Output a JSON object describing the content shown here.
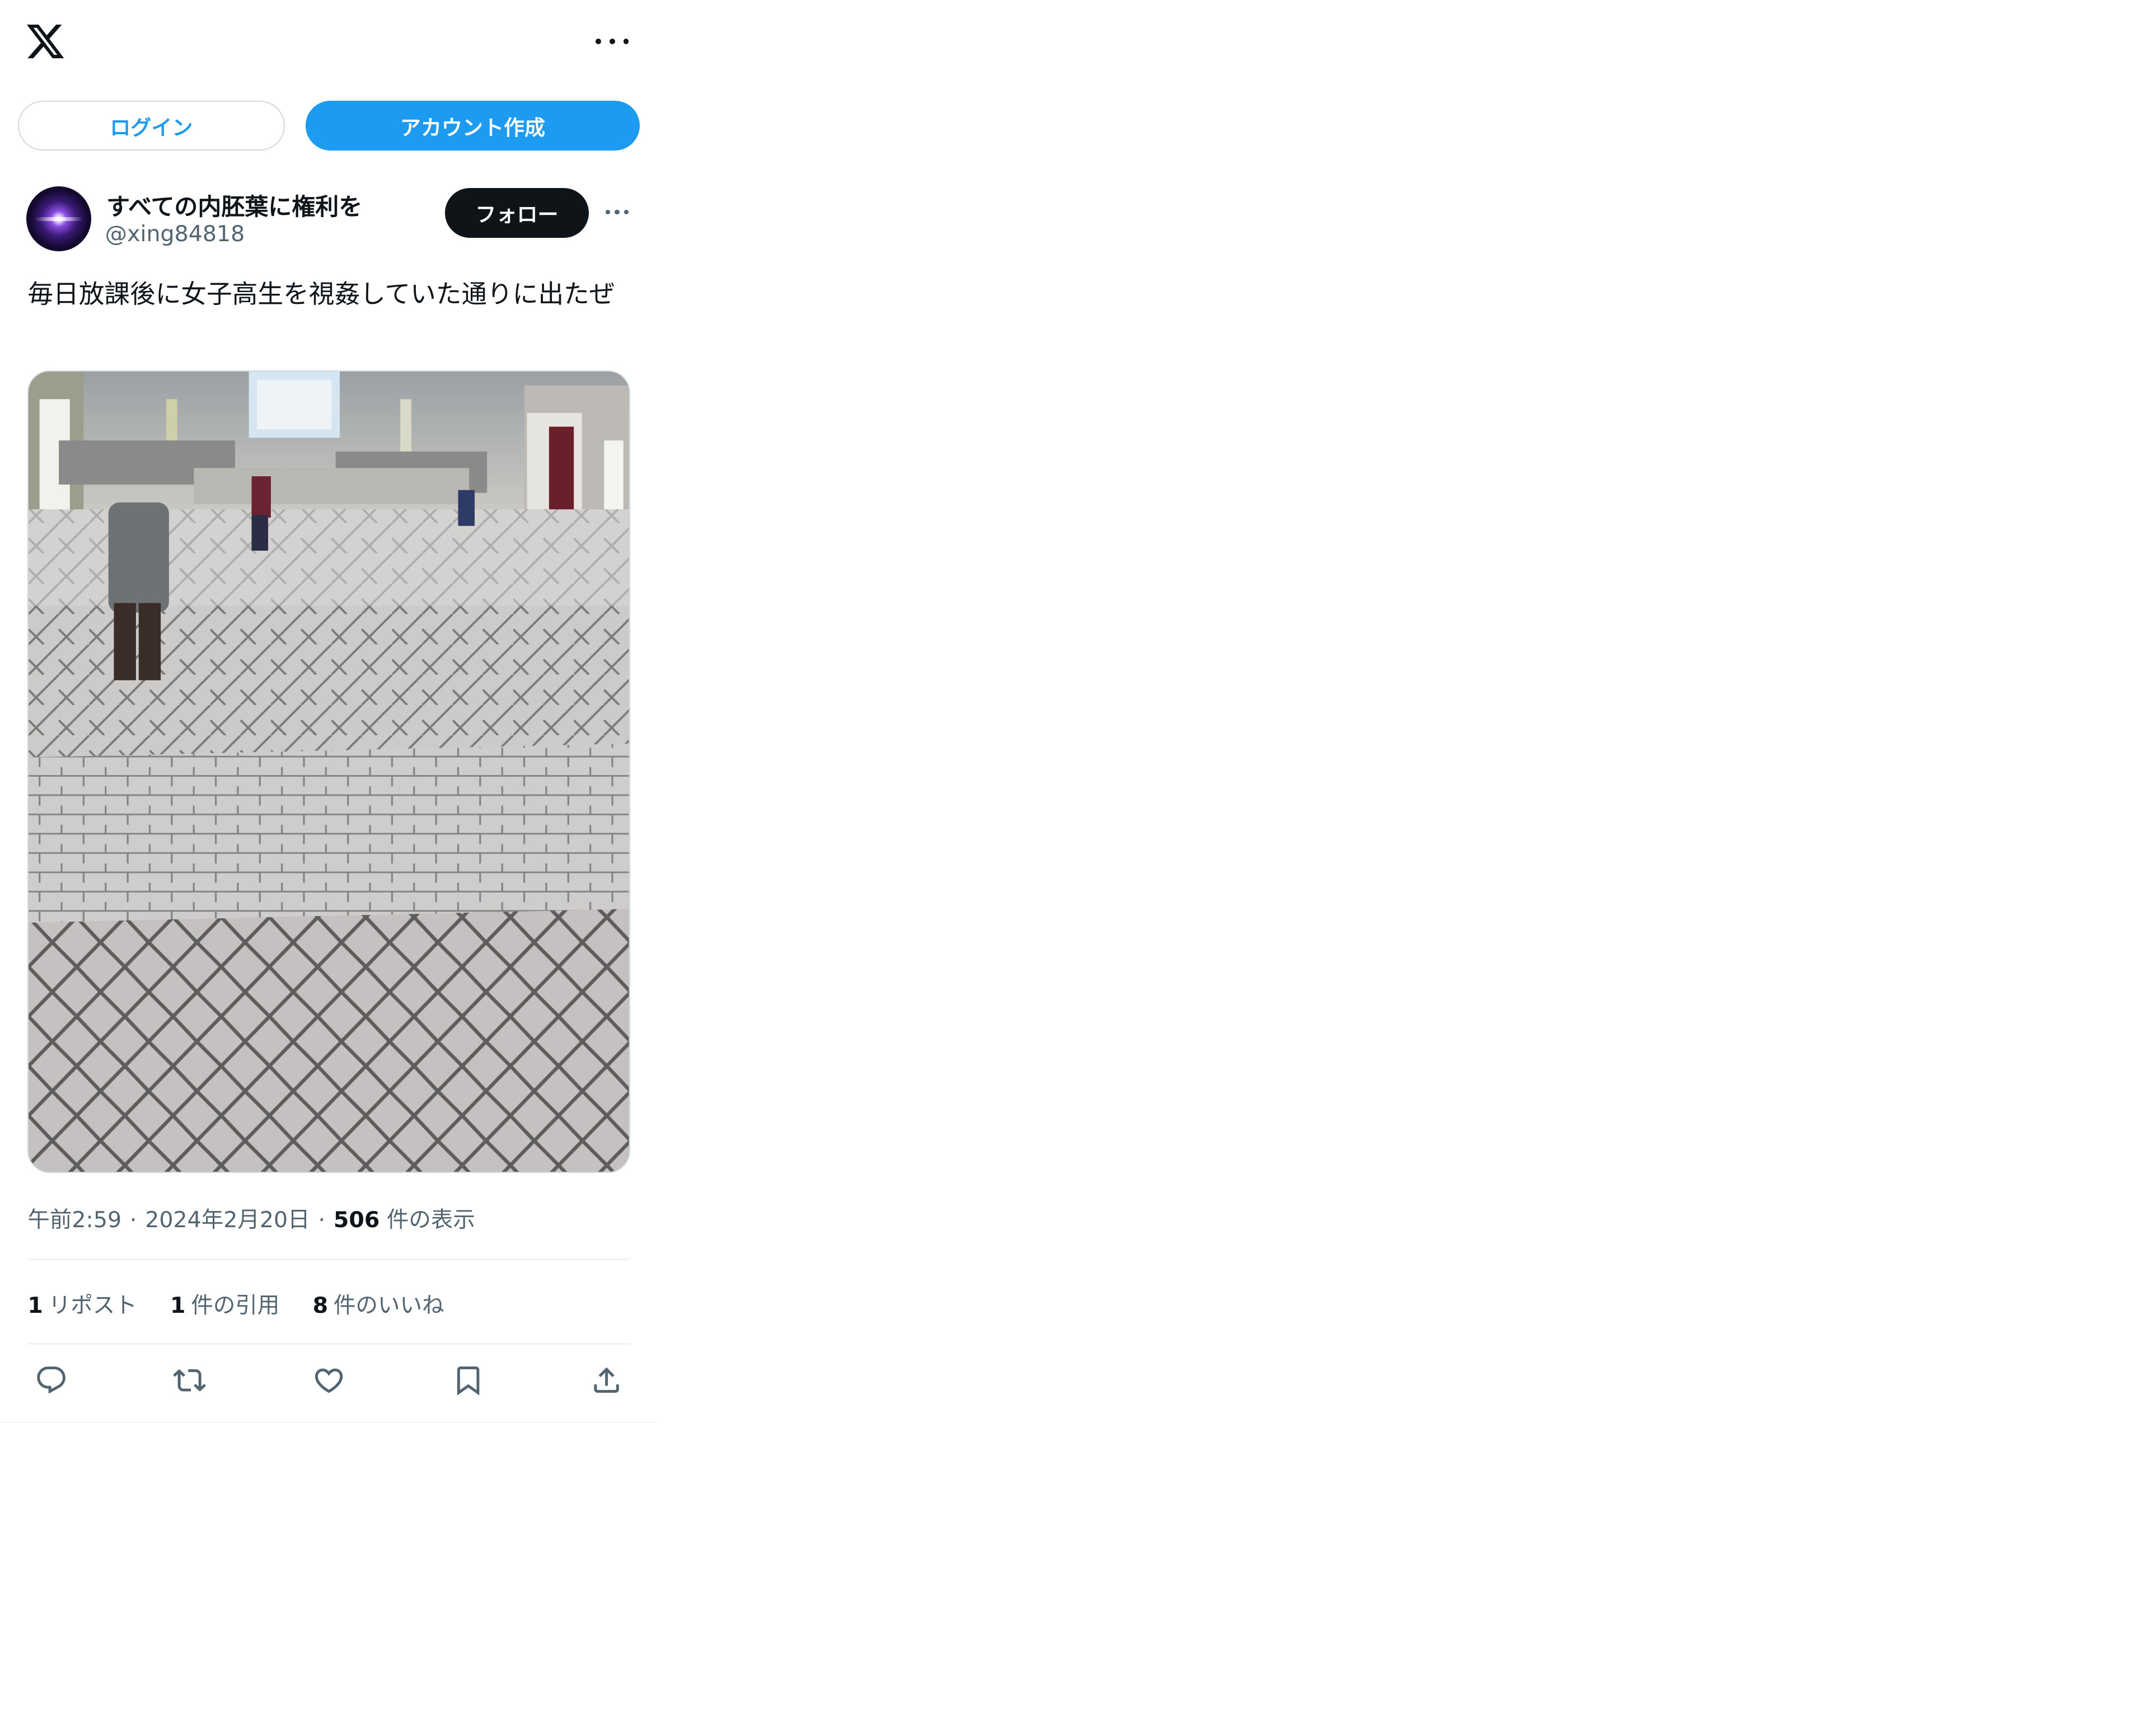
{
  "header": {
    "logo_icon": "x-logo-icon",
    "more_icon": "more-horizontal-icon"
  },
  "auth": {
    "login_label": "ログイン",
    "signup_label": "アカウント作成"
  },
  "tweet": {
    "author": {
      "display_name": "すべての内胚葉に権利を",
      "handle": "@xing84818"
    },
    "follow_label": "フォロー",
    "text": "毎日放課後に女子高生を視姦していた通りに出たぜ",
    "meta": {
      "time": "午前2:59",
      "date": "2024年2月20日",
      "views": "506",
      "views_label": "件の表示"
    },
    "stats": {
      "reposts": "1",
      "reposts_label": "リポスト",
      "quotes": "1",
      "quotes_label": "件の引用",
      "likes": "8",
      "likes_label": "件のいいね"
    },
    "actions": [
      "reply-icon",
      "repost-icon",
      "like-icon",
      "bookmark-icon",
      "share-icon"
    ]
  },
  "colors": {
    "accent": "#1d9bf0",
    "text": "#0f1419",
    "secondary": "#536471",
    "follow_bg": "#0f1419",
    "divider": "#eff3f4"
  }
}
